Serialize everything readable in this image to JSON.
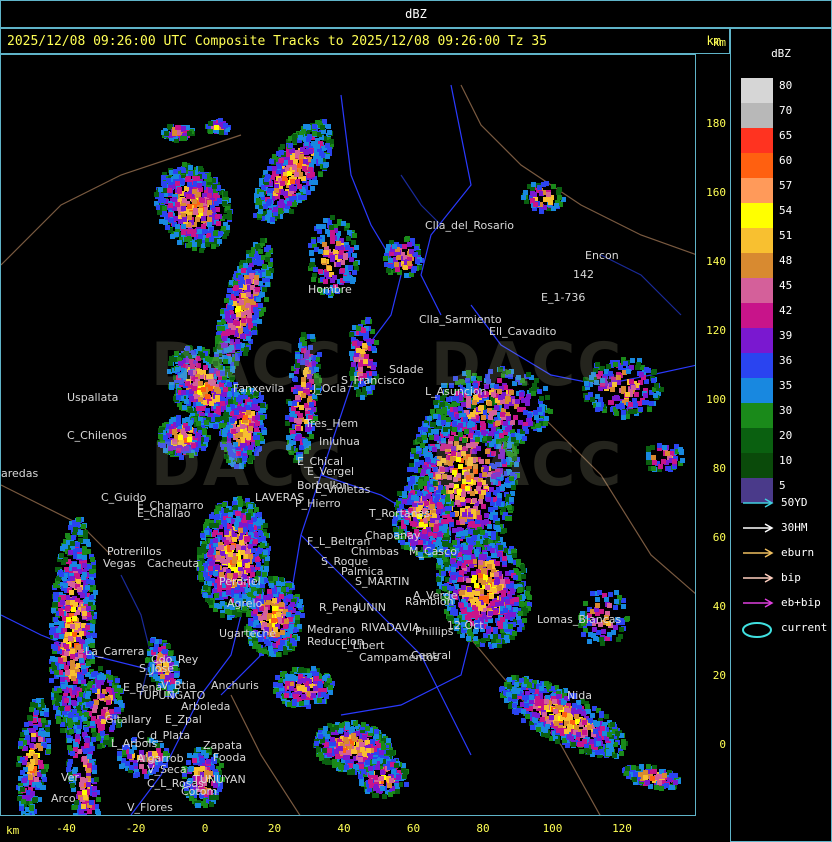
{
  "header": {
    "title": "dBZ"
  },
  "titlebar": {
    "text": "2025/12/08 09:26:00 UTC Composite Tracks to 2025/12/08 09:26:00 Tz 35",
    "unit": "km"
  },
  "watermark": {
    "text": "DACC"
  },
  "axes": {
    "y_unit": "km",
    "x_unit": "km",
    "y_ticks": [
      "180",
      "160",
      "140",
      "120",
      "100",
      "80",
      "60",
      "40",
      "20",
      "0"
    ],
    "x_ticks": [
      "-40",
      "-20",
      "0",
      "20",
      "40",
      "60",
      "80",
      "100",
      "120"
    ]
  },
  "legend": {
    "unit": "dBZ",
    "scale": [
      {
        "label": "80",
        "color": "#d6d6d6"
      },
      {
        "label": "70",
        "color": "#b8b8b8"
      },
      {
        "label": "65",
        "color": "#ff3320"
      },
      {
        "label": "60",
        "color": "#ff6010"
      },
      {
        "label": "57",
        "color": "#ff9a5a"
      },
      {
        "label": "54",
        "color": "#ffff00"
      },
      {
        "label": "51",
        "color": "#f8c030"
      },
      {
        "label": "48",
        "color": "#d88a30"
      },
      {
        "label": "45",
        "color": "#d4609a"
      },
      {
        "label": "42",
        "color": "#c8148a"
      },
      {
        "label": "39",
        "color": "#7a18d0"
      },
      {
        "label": "36",
        "color": "#2a44f0"
      },
      {
        "label": "35",
        "color": "#1888e0"
      },
      {
        "label": "30",
        "color": "#1a8a1a"
      },
      {
        "label": "20",
        "color": "#0a6010"
      },
      {
        "label": "10",
        "color": "#0a4a0a"
      },
      {
        "label": "5",
        "color": "#4a3a8a"
      }
    ],
    "tracks": [
      {
        "label": "50YD",
        "color": "#40d0e0"
      },
      {
        "label": "30HM",
        "color": "#ffffff"
      },
      {
        "label": "eburn",
        "color": "#f0c060"
      },
      {
        "label": "bip",
        "color": "#ffd0c0"
      },
      {
        "label": "eb+bip",
        "color": "#e040e0"
      }
    ],
    "current_label": "current",
    "current_color": "#40e0e0"
  },
  "places": [
    {
      "name": "Clla_del_Rosario"
    },
    {
      "name": "Encon"
    },
    {
      "name": "142"
    },
    {
      "name": "E_1-736"
    },
    {
      "name": "Hombre"
    },
    {
      "name": "Clla_Sarmiento"
    },
    {
      "name": "Ell_Cavadito"
    },
    {
      "name": "Uspallata"
    },
    {
      "name": "S_Francisco"
    },
    {
      "name": "Sdade"
    },
    {
      "name": "L_Asuncion"
    },
    {
      "name": "Fanxevila"
    },
    {
      "name": "J_Ocla"
    },
    {
      "name": "C_Chilenos"
    },
    {
      "name": "Tres_Hem"
    },
    {
      "name": "Inluhua"
    },
    {
      "name": "aredas"
    },
    {
      "name": "E_Chical"
    },
    {
      "name": "E_Vergel"
    },
    {
      "name": "Borbollon"
    },
    {
      "name": "C_Guido"
    },
    {
      "name": "L_Violetas"
    },
    {
      "name": "E_Chamarro"
    },
    {
      "name": "LAVERAS"
    },
    {
      "name": "P_Hierro"
    },
    {
      "name": "E_Challao"
    },
    {
      "name": "T_Rortanas"
    },
    {
      "name": "Chapanay"
    },
    {
      "name": "F_L_Beltran"
    },
    {
      "name": "Chimbas"
    },
    {
      "name": "M_Casco"
    },
    {
      "name": "Potrerillos"
    },
    {
      "name": "Vegas"
    },
    {
      "name": "Cacheuta"
    },
    {
      "name": "S_Roque"
    },
    {
      "name": "Palmica"
    },
    {
      "name": "S_MARTIN"
    },
    {
      "name": "A_Verde"
    },
    {
      "name": "Ramblon"
    },
    {
      "name": "Perdriel"
    },
    {
      "name": "Agrelo"
    },
    {
      "name": "R_Pena"
    },
    {
      "name": "JUNIN"
    },
    {
      "name": "Lomas_Blancas"
    },
    {
      "name": "Ugarteche"
    },
    {
      "name": "Medrano"
    },
    {
      "name": "Reduccion"
    },
    {
      "name": "RIVADAVIA"
    },
    {
      "name": "Phillips"
    },
    {
      "name": "12 Oct"
    },
    {
      "name": "La_Carrera"
    },
    {
      "name": "Cdo_Rey"
    },
    {
      "name": "S_Jose"
    },
    {
      "name": "L_Libert"
    },
    {
      "name": "Campamentos"
    },
    {
      "name": "Central"
    },
    {
      "name": "E_Pena"
    },
    {
      "name": "V_Btia"
    },
    {
      "name": "Anchuris"
    },
    {
      "name": "TUPUNGATO"
    },
    {
      "name": "Arboleda"
    },
    {
      "name": "Gltallary"
    },
    {
      "name": "E_Zpal"
    },
    {
      "name": "L_Arbols"
    },
    {
      "name": "C_d_Plata"
    },
    {
      "name": "Algarrob"
    },
    {
      "name": "V_Seca"
    },
    {
      "name": "Zapata"
    },
    {
      "name": "Fooda"
    },
    {
      "name": "TUNUYAN"
    },
    {
      "name": "C_L_Rosas"
    },
    {
      "name": "Cotom"
    },
    {
      "name": "V_Flores"
    },
    {
      "name": "Arco"
    },
    {
      "name": "Nida"
    },
    {
      "name": "Ver"
    }
  ]
}
